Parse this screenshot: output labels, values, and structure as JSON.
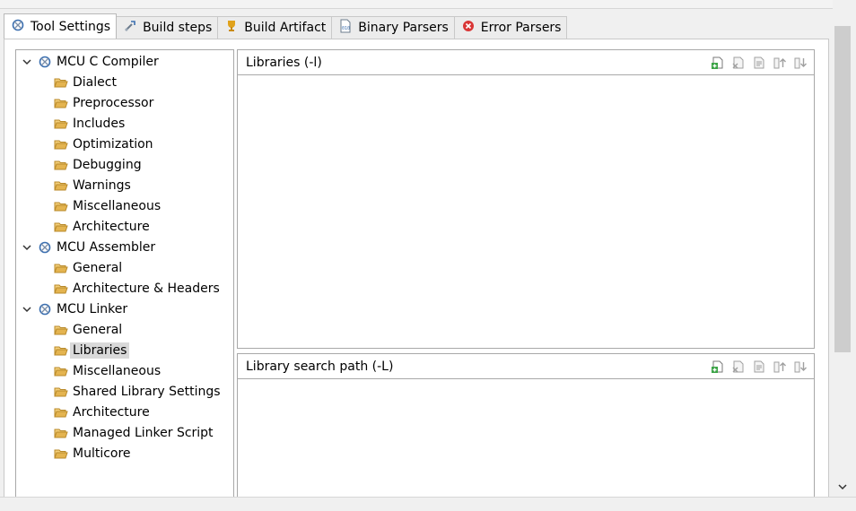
{
  "tabs": [
    {
      "label": "Tool Settings",
      "icon": "tool-settings-icon",
      "active": true
    },
    {
      "label": "Build steps",
      "icon": "build-steps-icon"
    },
    {
      "label": "Build Artifact",
      "icon": "build-artifact-icon"
    },
    {
      "label": "Binary Parsers",
      "icon": "binary-parsers-icon"
    },
    {
      "label": "Error Parsers",
      "icon": "error-parsers-icon"
    }
  ],
  "tree": {
    "groups": [
      {
        "label": "MCU C Compiler",
        "items": [
          "Dialect",
          "Preprocessor",
          "Includes",
          "Optimization",
          "Debugging",
          "Warnings",
          "Miscellaneous",
          "Architecture"
        ]
      },
      {
        "label": "MCU Assembler",
        "items": [
          "General",
          "Architecture & Headers"
        ]
      },
      {
        "label": "MCU Linker",
        "items": [
          "General",
          "Libraries",
          "Miscellaneous",
          "Shared Library Settings",
          "Architecture",
          "Managed Linker Script",
          "Multicore"
        ]
      }
    ],
    "selected": "Libraries"
  },
  "libraries_panel": {
    "title": "Libraries (-l)"
  },
  "search_path_panel": {
    "title": "Library search path (-L)"
  },
  "colors": {
    "folder": "#d9a441",
    "gear": "#3b6fb0",
    "error_red": "#d93636",
    "trophy": "#e0a21b"
  }
}
